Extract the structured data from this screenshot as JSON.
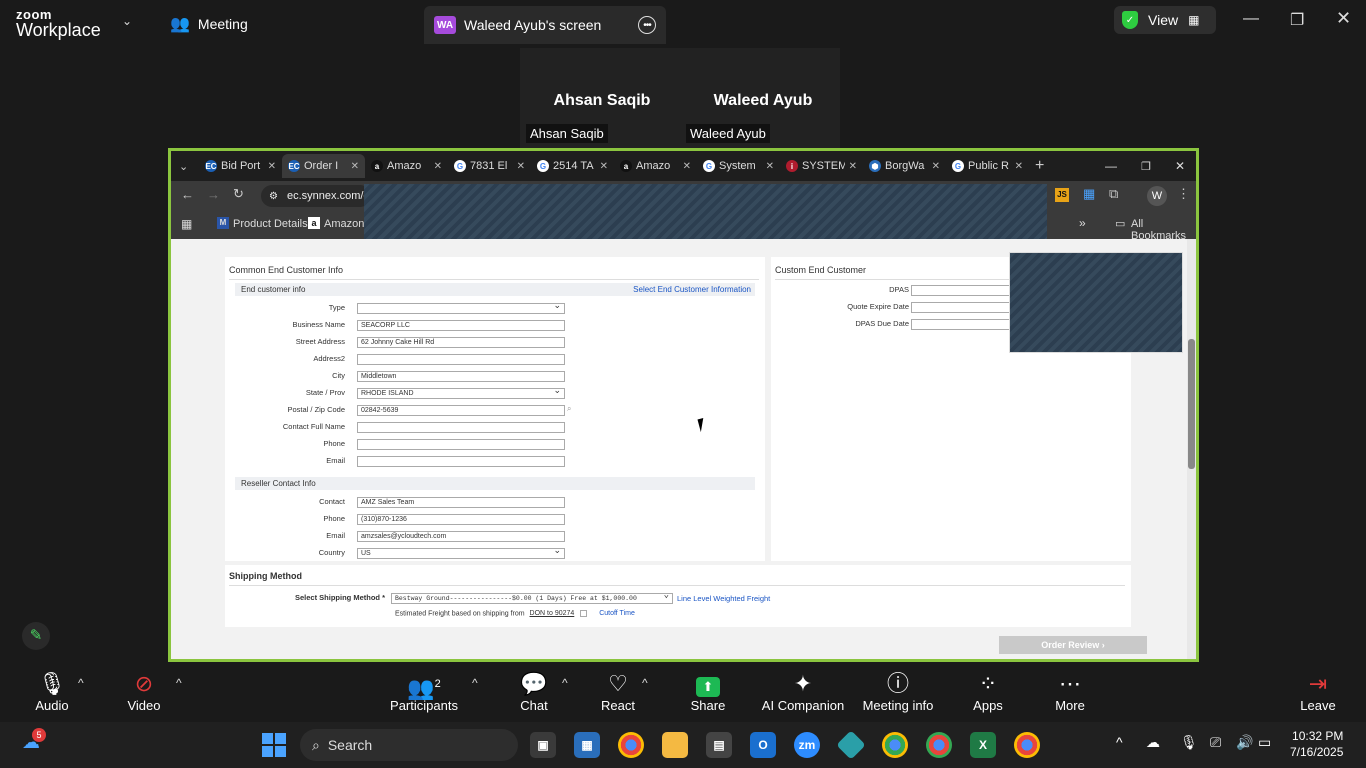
{
  "zoom": {
    "brand_line1": "zoom",
    "brand_line2": "Workplace",
    "meeting_label": "Meeting",
    "share_badge": "WA",
    "share_title": "Waleed Ayub's screen",
    "view_label": "View",
    "participants": [
      {
        "name": "Ahsan Saqib",
        "label": "Ahsan Saqib"
      },
      {
        "name": "Waleed Ayub",
        "label": "Waleed Ayub"
      }
    ],
    "toolbar": {
      "audio": "Audio",
      "video": "Video",
      "participants": "Participants",
      "participants_count": "2",
      "chat": "Chat",
      "react": "React",
      "share": "Share",
      "ai_companion": "AI Companion",
      "meeting_info": "Meeting info",
      "apps": "Apps",
      "more": "More",
      "leave": "Leave"
    }
  },
  "browser": {
    "tabs": [
      {
        "label": "Bid Port",
        "fav": "EC",
        "color": "#1a5fb4"
      },
      {
        "label": "Order I",
        "fav": "EC",
        "color": "#1a5fb4",
        "active": true
      },
      {
        "label": "Amazo",
        "fav": "a",
        "color": "#111"
      },
      {
        "label": "7831 El",
        "fav": "G",
        "color": "#fff"
      },
      {
        "label": "2514 TA",
        "fav": "G",
        "color": "#fff"
      },
      {
        "label": "Amazo",
        "fav": "a",
        "color": "#111"
      },
      {
        "label": "System",
        "fav": "G",
        "color": "#fff"
      },
      {
        "label": "SYSTEM",
        "fav": "i",
        "color": "#b01c2e"
      },
      {
        "label": "BorgWa",
        "fav": "⬢",
        "color": "#2a6ebb"
      },
      {
        "label": "Public R",
        "fav": "G",
        "color": "#fff"
      }
    ],
    "url": "ec.synnex.com/e",
    "bookmarks": [
      "Product Details",
      "Amazon.co"
    ],
    "all_bookmarks": "All Bookmarks",
    "avatar_letter": "W"
  },
  "order_page": {
    "common_title": "Common End Customer Info",
    "end_customer_sub": "End customer info",
    "select_end_customer_link": "Select End Customer Information",
    "fields": [
      {
        "label": "Type",
        "value": "",
        "select": true
      },
      {
        "label": "Business Name",
        "value": "SEACORP LLC"
      },
      {
        "label": "Street Address",
        "value": "62 Johnny Cake Hill Rd"
      },
      {
        "label": "Address2",
        "value": ""
      },
      {
        "label": "City",
        "value": "Middletown"
      },
      {
        "label": "State / Prov",
        "value": "RHODE ISLAND",
        "select": true
      },
      {
        "label": "Postal / Zip Code",
        "value": "02842-5639"
      },
      {
        "label": "Contact Full Name",
        "value": ""
      },
      {
        "label": "Phone",
        "value": ""
      },
      {
        "label": "Email",
        "value": ""
      }
    ],
    "reseller_sub": "Reseller Contact Info",
    "reseller_fields": [
      {
        "label": "Contact",
        "value": "AMZ Sales Team"
      },
      {
        "label": "Phone",
        "value": "(310)870-1236"
      },
      {
        "label": "Email",
        "value": "amzsales@ycloudtech.com"
      },
      {
        "label": "Country",
        "value": "US",
        "select": true
      }
    ],
    "custom_title": "Custom End Customer",
    "custom_fields": [
      {
        "label": "DPAS",
        "value": ""
      },
      {
        "label": "Quote Expire Date",
        "value": ""
      },
      {
        "label": "DPAS Due Date",
        "value": ""
      }
    ],
    "shipping_title": "Shipping Method",
    "shipping_label": "Select Shipping Method *",
    "shipping_value": "Bestway Ground----------------$0.00 (1 Days) Free at $1,000.00",
    "line_level_link": "Line Level Weighted Freight",
    "estimated_freight": "Estimated Freight based on shipping from",
    "don_link": "DON to 90274",
    "cutoff_link": "Cutoff Time",
    "order_review": "Order Review"
  },
  "taskbar": {
    "search": "Search",
    "time": "10:32 PM",
    "date": "7/16/2025",
    "weather_badge": "5"
  }
}
